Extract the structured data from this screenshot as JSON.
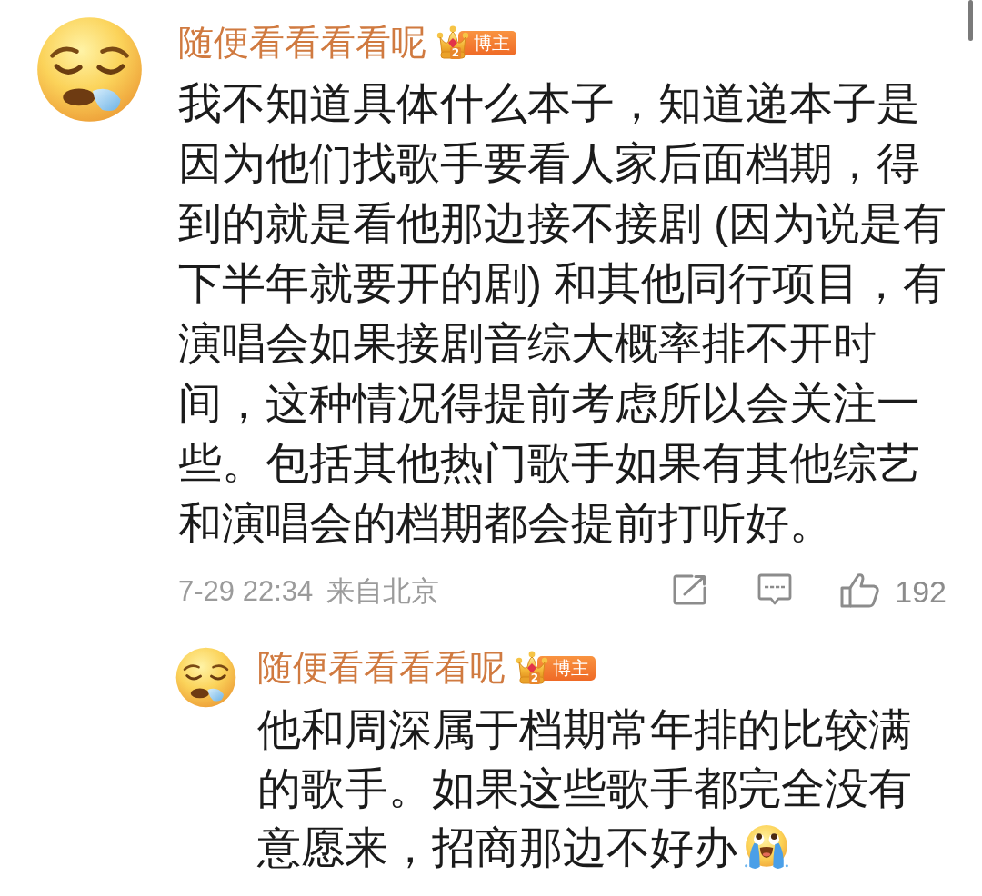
{
  "comment": {
    "author": {
      "name": "随便看看看看呢",
      "badge": {
        "level": "2",
        "label": "博主"
      }
    },
    "text": "我不知道具体什么本子，知道递本子是因为他们找歌手要看人家后面档期，得到的就是看他那边接不接剧 (因为说是有下半年就要开的剧) 和其他同行项目，有演唱会如果接剧音综大概率排不开时间，这种情况得提前考虑所以会关注一些。包括其他热门歌手如果有其他综艺和演唱会的档期都会提前打听好。",
    "time": "7-29 22:34",
    "location": "来自北京",
    "likes": "192"
  },
  "replies": [
    {
      "author": {
        "name": "随便看看看看呢",
        "badge": {
          "level": "2",
          "label": "博主"
        }
      },
      "text": "他和周深属于档期常年排的比较满的歌手。如果这些歌手都完全没有意愿来，招商那边不好办"
    }
  ]
}
